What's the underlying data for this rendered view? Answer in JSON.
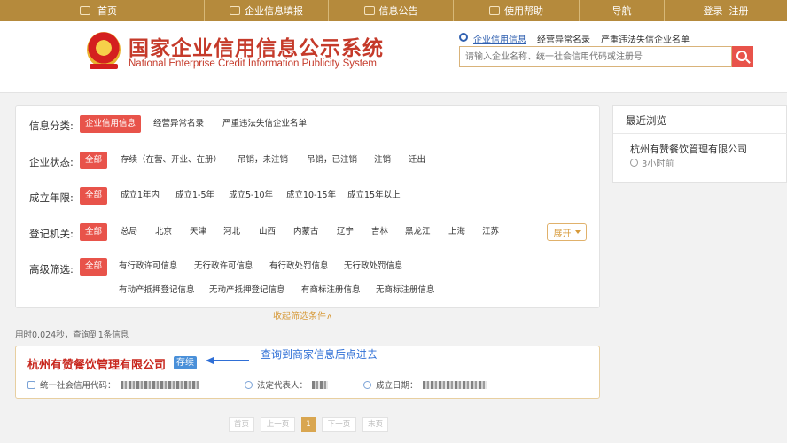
{
  "nav": {
    "home": "首页",
    "fill": "企业信息填报",
    "notice": "信息公告",
    "help": "使用帮助",
    "guide": "导航",
    "login": "登录",
    "register": "注册"
  },
  "header": {
    "title_cn": "国家企业信用信息公示系统",
    "title_en": "National Enterprise Credit Information Publicity System"
  },
  "search": {
    "tabs": [
      "企业信用信息",
      "经营异常名录",
      "严重违法失信企业名单"
    ],
    "active_tab": "企业信用信息",
    "placeholder": "请输入企业名称、统一社会信用代码或注册号"
  },
  "filters": {
    "info_category": {
      "label": "信息分类:",
      "options": [
        "企业信用信息",
        "经营异常名录",
        "严重违法失信企业名单"
      ],
      "selected": "企业信用信息"
    },
    "status": {
      "label": "企业状态:",
      "options": [
        "全部",
        "存续（在营、开业、在册）",
        "吊销，未注销",
        "吊销，已注销",
        "注销",
        "迁出"
      ],
      "selected": "全部"
    },
    "age": {
      "label": "成立年限:",
      "options": [
        "全部",
        "成立1年内",
        "成立1-5年",
        "成立5-10年",
        "成立10-15年",
        "成立15年以上"
      ],
      "selected": "全部"
    },
    "authority": {
      "label": "登记机关:",
      "options": [
        "全部",
        "总局",
        "北京",
        "天津",
        "河北",
        "山西",
        "内蒙古",
        "辽宁",
        "吉林",
        "黑龙江",
        "上海",
        "江苏"
      ],
      "selected": "全部",
      "expand_label": "展开"
    },
    "advanced": {
      "label": "高级筛选:",
      "options_row1": [
        "全部",
        "有行政许可信息",
        "无行政许可信息",
        "有行政处罚信息",
        "无行政处罚信息"
      ],
      "options_row2": [
        "有动产抵押登记信息",
        "无动产抵押登记信息",
        "有商标注册信息",
        "无商标注册信息"
      ],
      "selected": "全部"
    },
    "collapse_label": "收起筛选条件∧"
  },
  "stats": "用时0.024秒，查询到1条信息",
  "result": {
    "name": "杭州有赞餐饮管理有限公司",
    "status": "存续",
    "credit_code_label": "统一社会信用代码：",
    "legal_rep_label": "法定代表人：",
    "founded_label": "成立日期："
  },
  "annotation": "查询到商家信息后点进去",
  "pager": {
    "first": "首页",
    "prev": "上一页",
    "current": "1",
    "next": "下一页",
    "last": "末页"
  },
  "recent": {
    "title": "最近浏览",
    "item_name": "杭州有赞餐饮管理有限公司",
    "item_time": "3小时前"
  },
  "colors": {
    "nav_bg": "#b58a3c",
    "accent_red": "#e8534a",
    "title_red": "#c53a2a",
    "link_blue": "#3060b0",
    "badge_blue": "#4a90d9",
    "annot_blue": "#2f6fd6",
    "gold": "#d9a650"
  }
}
